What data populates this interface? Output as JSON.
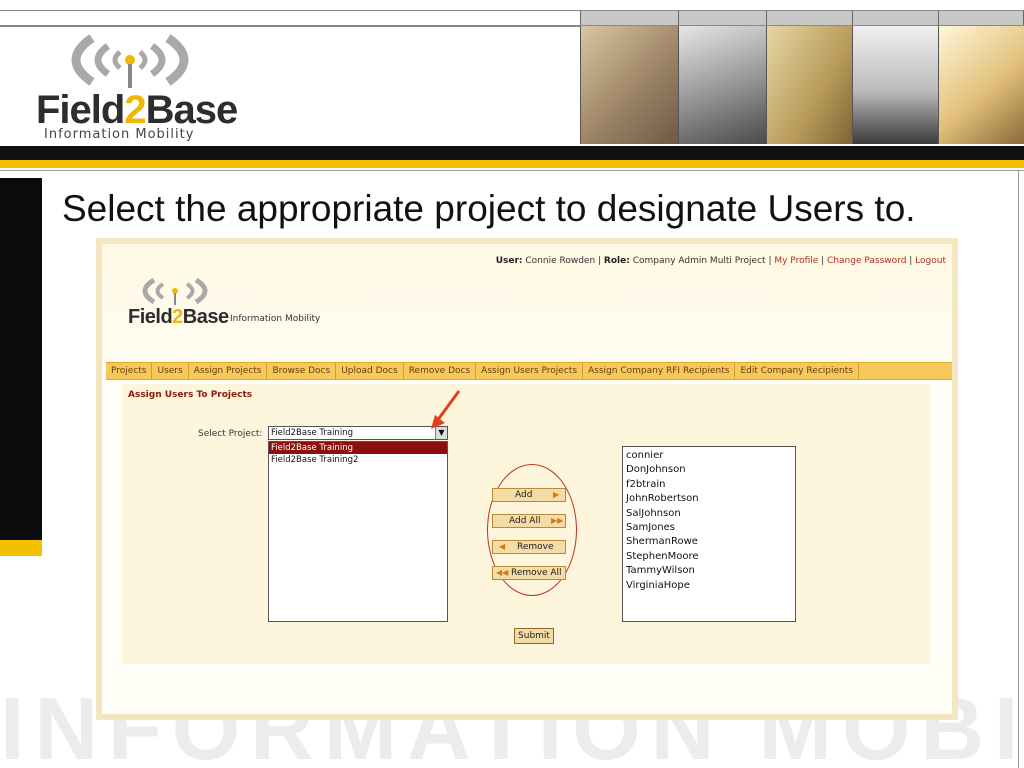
{
  "slide": {
    "logo": {
      "name_part1": "Field",
      "name_part2": "2",
      "name_part3": "Base",
      "tagline": "Information Mobility"
    },
    "title": "Select the appropriate project to designate Users to.",
    "watermark": "INFORMATION MOBILITY"
  },
  "app": {
    "user_bar": {
      "user_label": "User:",
      "user_name": "Connie Rowden",
      "role_label": "Role:",
      "role_name": "Company Admin Multi Project",
      "links": [
        "My Profile",
        "Change Password",
        "Logout"
      ]
    },
    "logo": {
      "name_part1": "Field",
      "name_part2": "2",
      "name_part3": "Base",
      "tagline": "Information Mobility"
    },
    "nav": [
      "Projects",
      "Users",
      "Assign Projects",
      "Browse Docs",
      "Upload Docs",
      "Remove Docs",
      "Assign Users Projects",
      "Assign Company RFI Recipients",
      "Edit Company Recipients"
    ],
    "section_title": "Assign Users To Projects",
    "select_label": "Select Project:",
    "select_value": "Field2Base Training",
    "dropdown_options": [
      "Field2Base Training",
      "Field2Base Training2"
    ],
    "buttons": {
      "add": "Add",
      "add_all": "Add All",
      "remove": "Remove",
      "remove_all": "Remove All",
      "submit": "Submit"
    },
    "users": [
      "connier",
      "DonJohnson",
      "f2btrain",
      "JohnRobertson",
      "SalJohnson",
      "SamJones",
      "ShermanRowe",
      "StephenMoore",
      "TammyWilson",
      "VirginiaHope"
    ]
  },
  "colors": {
    "accent_yellow": "#f2c200",
    "nav_orange": "#f7c85a",
    "highlight_red": "#8b0f0f",
    "annotation_red": "#c0301c"
  }
}
